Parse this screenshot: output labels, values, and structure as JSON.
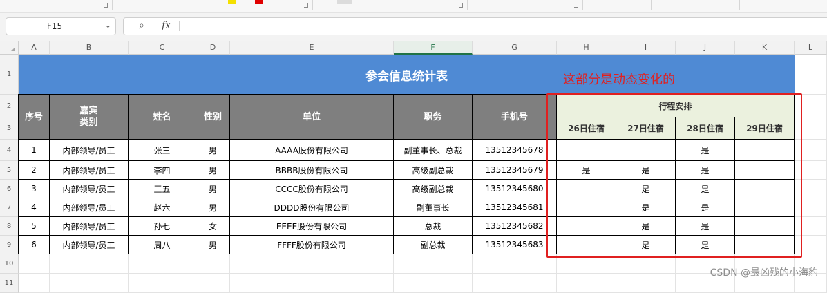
{
  "formula_bar": {
    "name_box": "F15",
    "fx_label": "fx",
    "formula": ""
  },
  "columns": [
    "A",
    "B",
    "C",
    "D",
    "E",
    "F",
    "G",
    "H",
    "I",
    "J",
    "K",
    "L"
  ],
  "active_column": "F",
  "rows": [
    "1",
    "2",
    "3",
    "4",
    "5",
    "6",
    "7",
    "8",
    "9",
    "10",
    "11"
  ],
  "sheet": {
    "title": "参会信息统计表",
    "headers": {
      "seq": "序号",
      "guest_type": "嘉宾\n类别",
      "name": "姓名",
      "gender": "性别",
      "org": "单位",
      "position": "职务",
      "phone": "手机号",
      "schedule_group": "行程安排",
      "days": [
        "26日住宿",
        "27日住宿",
        "28日住宿",
        "29日住宿"
      ]
    },
    "records": [
      {
        "seq": "1",
        "type": "内部领导/员工",
        "name": "张三",
        "gender": "男",
        "org": "AAAA股份有限公司",
        "position": "副董事长、总裁",
        "phone": "13512345678",
        "d26": "",
        "d27": "",
        "d28": "是",
        "d29": ""
      },
      {
        "seq": "2",
        "type": "内部领导/员工",
        "name": "李四",
        "gender": "男",
        "org": "BBBB股份有限公司",
        "position": "高级副总裁",
        "phone": "13512345679",
        "d26": "是",
        "d27": "是",
        "d28": "是",
        "d29": ""
      },
      {
        "seq": "3",
        "type": "内部领导/员工",
        "name": "王五",
        "gender": "男",
        "org": "CCCC股份有限公司",
        "position": "高级副总裁",
        "phone": "13512345680",
        "d26": "",
        "d27": "是",
        "d28": "是",
        "d29": ""
      },
      {
        "seq": "4",
        "type": "内部领导/员工",
        "name": "赵六",
        "gender": "男",
        "org": "DDDD股份有限公司",
        "position": "副董事长",
        "phone": "13512345681",
        "d26": "",
        "d27": "是",
        "d28": "是",
        "d29": ""
      },
      {
        "seq": "5",
        "type": "内部领导/员工",
        "name": "孙七",
        "gender": "女",
        "org": "EEEE股份有限公司",
        "position": "总裁",
        "phone": "13512345682",
        "d26": "",
        "d27": "是",
        "d28": "是",
        "d29": ""
      },
      {
        "seq": "6",
        "type": "内部领导/员工",
        "name": "周八",
        "gender": "男",
        "org": "FFFF股份有限公司",
        "position": "副总裁",
        "phone": "13512345683",
        "d26": "",
        "d27": "是",
        "d28": "是",
        "d29": ""
      }
    ]
  },
  "annotation": "这部分是动态变化的",
  "watermark": "CSDN @最凶残的小海豹",
  "colors": {
    "title_bg": "#4f8ad4",
    "header_bg": "#7f7f7f",
    "schedule_header_bg": "#ebf1de",
    "annotation": "#e02020"
  }
}
